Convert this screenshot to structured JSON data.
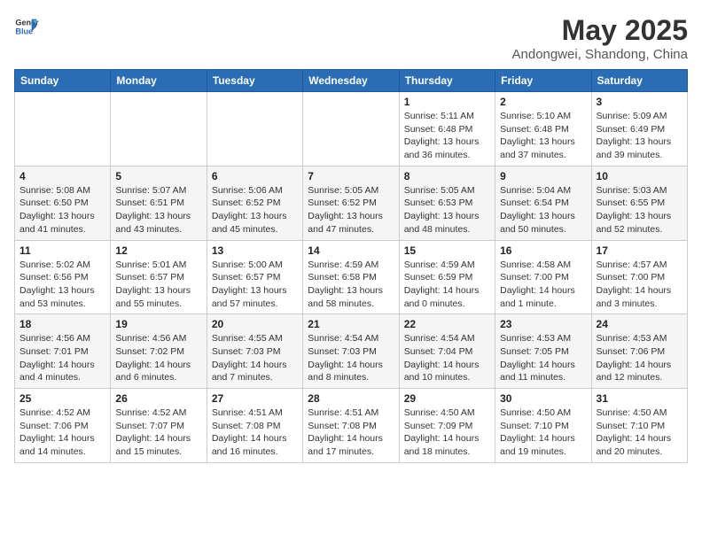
{
  "header": {
    "logo_general": "General",
    "logo_blue": "Blue",
    "month_title": "May 2025",
    "subtitle": "Andongwei, Shandong, China"
  },
  "days_of_week": [
    "Sunday",
    "Monday",
    "Tuesday",
    "Wednesday",
    "Thursday",
    "Friday",
    "Saturday"
  ],
  "weeks": [
    [
      {
        "date": "",
        "info": ""
      },
      {
        "date": "",
        "info": ""
      },
      {
        "date": "",
        "info": ""
      },
      {
        "date": "",
        "info": ""
      },
      {
        "date": "1",
        "info": "Sunrise: 5:11 AM\nSunset: 6:48 PM\nDaylight: 13 hours and 36 minutes."
      },
      {
        "date": "2",
        "info": "Sunrise: 5:10 AM\nSunset: 6:48 PM\nDaylight: 13 hours and 37 minutes."
      },
      {
        "date": "3",
        "info": "Sunrise: 5:09 AM\nSunset: 6:49 PM\nDaylight: 13 hours and 39 minutes."
      }
    ],
    [
      {
        "date": "4",
        "info": "Sunrise: 5:08 AM\nSunset: 6:50 PM\nDaylight: 13 hours and 41 minutes."
      },
      {
        "date": "5",
        "info": "Sunrise: 5:07 AM\nSunset: 6:51 PM\nDaylight: 13 hours and 43 minutes."
      },
      {
        "date": "6",
        "info": "Sunrise: 5:06 AM\nSunset: 6:52 PM\nDaylight: 13 hours and 45 minutes."
      },
      {
        "date": "7",
        "info": "Sunrise: 5:05 AM\nSunset: 6:52 PM\nDaylight: 13 hours and 47 minutes."
      },
      {
        "date": "8",
        "info": "Sunrise: 5:05 AM\nSunset: 6:53 PM\nDaylight: 13 hours and 48 minutes."
      },
      {
        "date": "9",
        "info": "Sunrise: 5:04 AM\nSunset: 6:54 PM\nDaylight: 13 hours and 50 minutes."
      },
      {
        "date": "10",
        "info": "Sunrise: 5:03 AM\nSunset: 6:55 PM\nDaylight: 13 hours and 52 minutes."
      }
    ],
    [
      {
        "date": "11",
        "info": "Sunrise: 5:02 AM\nSunset: 6:56 PM\nDaylight: 13 hours and 53 minutes."
      },
      {
        "date": "12",
        "info": "Sunrise: 5:01 AM\nSunset: 6:57 PM\nDaylight: 13 hours and 55 minutes."
      },
      {
        "date": "13",
        "info": "Sunrise: 5:00 AM\nSunset: 6:57 PM\nDaylight: 13 hours and 57 minutes."
      },
      {
        "date": "14",
        "info": "Sunrise: 4:59 AM\nSunset: 6:58 PM\nDaylight: 13 hours and 58 minutes."
      },
      {
        "date": "15",
        "info": "Sunrise: 4:59 AM\nSunset: 6:59 PM\nDaylight: 14 hours and 0 minutes."
      },
      {
        "date": "16",
        "info": "Sunrise: 4:58 AM\nSunset: 7:00 PM\nDaylight: 14 hours and 1 minute."
      },
      {
        "date": "17",
        "info": "Sunrise: 4:57 AM\nSunset: 7:00 PM\nDaylight: 14 hours and 3 minutes."
      }
    ],
    [
      {
        "date": "18",
        "info": "Sunrise: 4:56 AM\nSunset: 7:01 PM\nDaylight: 14 hours and 4 minutes."
      },
      {
        "date": "19",
        "info": "Sunrise: 4:56 AM\nSunset: 7:02 PM\nDaylight: 14 hours and 6 minutes."
      },
      {
        "date": "20",
        "info": "Sunrise: 4:55 AM\nSunset: 7:03 PM\nDaylight: 14 hours and 7 minutes."
      },
      {
        "date": "21",
        "info": "Sunrise: 4:54 AM\nSunset: 7:03 PM\nDaylight: 14 hours and 8 minutes."
      },
      {
        "date": "22",
        "info": "Sunrise: 4:54 AM\nSunset: 7:04 PM\nDaylight: 14 hours and 10 minutes."
      },
      {
        "date": "23",
        "info": "Sunrise: 4:53 AM\nSunset: 7:05 PM\nDaylight: 14 hours and 11 minutes."
      },
      {
        "date": "24",
        "info": "Sunrise: 4:53 AM\nSunset: 7:06 PM\nDaylight: 14 hours and 12 minutes."
      }
    ],
    [
      {
        "date": "25",
        "info": "Sunrise: 4:52 AM\nSunset: 7:06 PM\nDaylight: 14 hours and 14 minutes."
      },
      {
        "date": "26",
        "info": "Sunrise: 4:52 AM\nSunset: 7:07 PM\nDaylight: 14 hours and 15 minutes."
      },
      {
        "date": "27",
        "info": "Sunrise: 4:51 AM\nSunset: 7:08 PM\nDaylight: 14 hours and 16 minutes."
      },
      {
        "date": "28",
        "info": "Sunrise: 4:51 AM\nSunset: 7:08 PM\nDaylight: 14 hours and 17 minutes."
      },
      {
        "date": "29",
        "info": "Sunrise: 4:50 AM\nSunset: 7:09 PM\nDaylight: 14 hours and 18 minutes."
      },
      {
        "date": "30",
        "info": "Sunrise: 4:50 AM\nSunset: 7:10 PM\nDaylight: 14 hours and 19 minutes."
      },
      {
        "date": "31",
        "info": "Sunrise: 4:50 AM\nSunset: 7:10 PM\nDaylight: 14 hours and 20 minutes."
      }
    ]
  ]
}
